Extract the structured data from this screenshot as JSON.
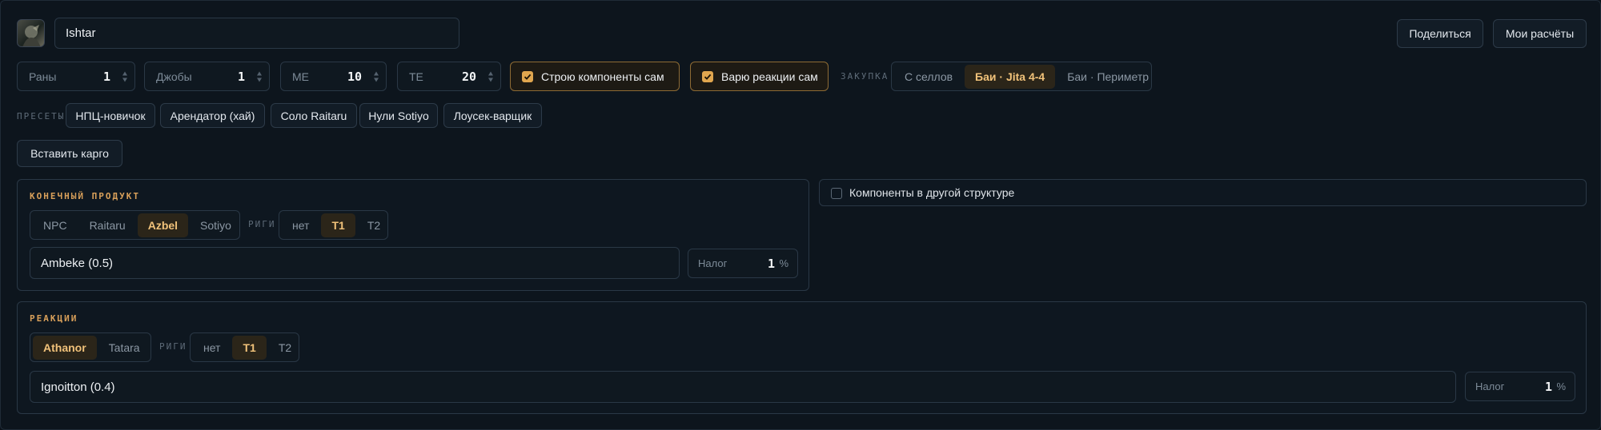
{
  "header": {
    "character_name": "Ishtar",
    "share_label": "Поделиться",
    "my_calcs_label": "Мои расчёты"
  },
  "params": {
    "runs": {
      "label": "Раны",
      "value": "1"
    },
    "jobs": {
      "label": "Джобы",
      "value": "1"
    },
    "me": {
      "label": "ME",
      "value": "10"
    },
    "te": {
      "label": "TE",
      "value": "20"
    },
    "build_components": {
      "label": "Строю компоненты сам",
      "checked": true
    },
    "cook_reactions": {
      "label": "Варю реакции сам",
      "checked": true
    },
    "purchase": {
      "caption": "ЗАКУПКА",
      "options": [
        "С селлов",
        "Баи · Jita 4-4",
        "Баи · Периметр"
      ],
      "selected": "Баи · Jita 4-4"
    }
  },
  "presets": {
    "caption": "ПРЕСЕТЫ",
    "items": [
      "НПЦ-новичок",
      "Арендатор (хай)",
      "Соло Raitaru",
      "Нули Sotiyo",
      "Лоусек-варщик"
    ]
  },
  "paste_cargo_label": "Вставить карго",
  "final_product": {
    "title": "КОНЕЧНЫЙ ПРОДУКТ",
    "structures": [
      "NPC",
      "Raitaru",
      "Azbel",
      "Sotiyo"
    ],
    "structure_selected": "Azbel",
    "rigs_caption": "РИГИ",
    "rigs": [
      "нет",
      "T1",
      "T2"
    ],
    "rig_selected": "T1",
    "system": "Ambeke (0.5)",
    "tax_label": "Налог",
    "tax_value": "1",
    "tax_unit": "%"
  },
  "components_other_structure": {
    "label": "Компоненты в другой структуре",
    "checked": false
  },
  "reactions": {
    "title": "РЕАКЦИИ",
    "structures": [
      "Athanor",
      "Tatara"
    ],
    "structure_selected": "Athanor",
    "rigs_caption": "РИГИ",
    "rigs": [
      "нет",
      "T1",
      "T2"
    ],
    "rig_selected": "T1",
    "system": "Ignoitton (0.4)",
    "tax_label": "Налог",
    "tax_value": "1",
    "tax_unit": "%"
  },
  "colors": {
    "accent": "#e0a64f",
    "active_segment_bg": "#2b2519",
    "background": "#0d151d"
  }
}
